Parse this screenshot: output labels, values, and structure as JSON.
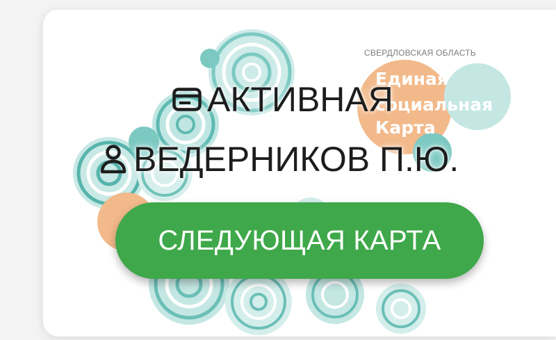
{
  "card": {
    "region": "СВЕРДЛОВСКАЯ ОБЛАСТЬ",
    "logo_line1": "Единая",
    "logo_line2": "социальная",
    "logo_line3": "Карта"
  },
  "status": {
    "icon": "credit-card-icon",
    "text": "АКТИВНАЯ"
  },
  "owner": {
    "icon": "person-icon",
    "name": "ВЕДЕРНИКОВ П.Ю."
  },
  "actions": {
    "next_card_label": "СЛЕДУЮЩАЯ КАРТА"
  },
  "colors": {
    "button": "#3fa84a",
    "pattern_teal": "#69c3bd",
    "pattern_light": "#bfe6e2",
    "accent_orange": "#f2b98a",
    "card_bg": "#ffffff"
  }
}
